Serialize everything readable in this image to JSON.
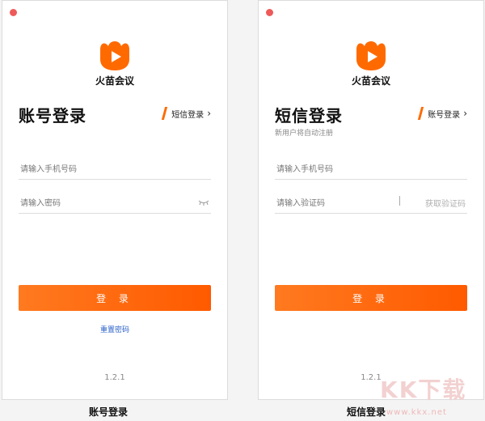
{
  "app": {
    "name": "火苗会议",
    "brand_color": "#ff6a00"
  },
  "left_panel": {
    "title": "账号登录",
    "switch_label": "短信登录",
    "phone_placeholder": "请输入手机号码",
    "password_placeholder": "请输入密码",
    "login_button": "登 录",
    "reset_link": "重置密码",
    "version": "1.2.1",
    "caption": "账号登录"
  },
  "right_panel": {
    "title": "短信登录",
    "subtitle": "新用户将自动注册",
    "switch_label": "账号登录",
    "phone_placeholder": "请输入手机号码",
    "code_placeholder": "请输入验证码",
    "get_code": "获取验证码",
    "login_button": "登 录",
    "version": "1.2.1",
    "caption": "短信登录"
  },
  "watermark": {
    "big": "KK下载",
    "small": "www.kkx.net"
  }
}
